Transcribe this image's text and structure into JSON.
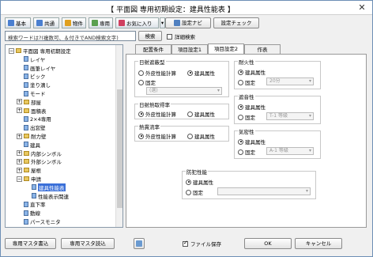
{
  "title": "【 平面図 専用初期設定：建具性能表 】",
  "toolbar": [
    {
      "label": "基本",
      "color": "#4a7fd0"
    },
    {
      "label": "共通",
      "color": "#4a7fd0"
    },
    {
      "label": "物件",
      "color": "#e0a020"
    },
    {
      "label": "専用",
      "color": "#5aa050"
    },
    {
      "label": "お気に入り",
      "color": "#d04060"
    }
  ],
  "toolbar_right": {
    "nav": "設定ナビ",
    "check": "設定チェック"
  },
  "search": {
    "placeholder": "検索ワードは?(複数可、＆付きでAND検索文字)",
    "button": "検索",
    "detail": "詳細検索"
  },
  "tree": [
    {
      "label": "平面図 専用初期設定",
      "indent": 0,
      "exp": "−",
      "icon": "folder"
    },
    {
      "label": "レイヤ",
      "indent": 1,
      "icon": "doc"
    },
    {
      "label": "画筆レイヤ",
      "indent": 1,
      "icon": "doc"
    },
    {
      "label": "ピック",
      "indent": 1,
      "icon": "doc"
    },
    {
      "label": "塗り潰し",
      "indent": 1,
      "icon": "doc"
    },
    {
      "label": "モード",
      "indent": 1,
      "icon": "doc"
    },
    {
      "label": "部屋",
      "indent": 1,
      "exp": "+",
      "icon": "folder"
    },
    {
      "label": "面積表",
      "indent": 1,
      "exp": "+",
      "icon": "folder"
    },
    {
      "label": "2×4専用",
      "indent": 1,
      "icon": "doc"
    },
    {
      "label": "出窓壁",
      "indent": 1,
      "icon": "doc"
    },
    {
      "label": "耐力壁",
      "indent": 1,
      "exp": "+",
      "icon": "folder"
    },
    {
      "label": "建具",
      "indent": 1,
      "icon": "doc"
    },
    {
      "label": "内部シンボル",
      "indent": 1,
      "exp": "+",
      "icon": "folder"
    },
    {
      "label": "外部シンボル",
      "indent": 1,
      "exp": "+",
      "icon": "folder"
    },
    {
      "label": "屋根",
      "indent": 1,
      "exp": "+",
      "icon": "folder"
    },
    {
      "label": "申請",
      "indent": 1,
      "exp": "−",
      "icon": "folder"
    },
    {
      "label": "建具性能表",
      "indent": 2,
      "icon": "doc",
      "selected": true
    },
    {
      "label": "性能表示関連",
      "indent": 2,
      "icon": "doc"
    },
    {
      "label": "直下率",
      "indent": 1,
      "icon": "doc"
    },
    {
      "label": "動線",
      "indent": 1,
      "icon": "doc"
    },
    {
      "label": "パースモニタ",
      "indent": 1,
      "icon": "doc"
    }
  ],
  "tabs": [
    "配置条件",
    "項目設定1",
    "項目設定2",
    "作表"
  ],
  "active_tab": 2,
  "groups": {
    "nissha": {
      "title": "日射遮蔽型",
      "opt1": "外皮性能計算",
      "opt2": "建具属性",
      "opt3": "固定",
      "combo": "(選)"
    },
    "nissha_shutoku": {
      "title": "日射熱取得率",
      "opt1": "外皮性能計算",
      "opt2": "建具属性"
    },
    "netsu": {
      "title": "熱貫流率",
      "opt1": "外皮性能計算",
      "opt2": "建具属性"
    },
    "taika": {
      "title": "耐火性",
      "opt1": "建具属性",
      "opt2": "固定",
      "combo": "20分"
    },
    "shaon": {
      "title": "遮音性",
      "opt1": "建具属性",
      "opt2": "固定",
      "combo": "T-1 等級"
    },
    "kimitsu": {
      "title": "気密性",
      "opt1": "建具属性",
      "opt2": "固定",
      "combo": "A-1 等級"
    },
    "bohan": {
      "title": "防犯性能",
      "opt1": "建具属性",
      "opt2": "固定",
      "combo": ""
    }
  },
  "bottom": {
    "set_write": "専用マスタ書込",
    "set_read": "専用マスタ読込",
    "save_file": "ファイル保存",
    "ok": "OK",
    "cancel": "キャンセル"
  }
}
